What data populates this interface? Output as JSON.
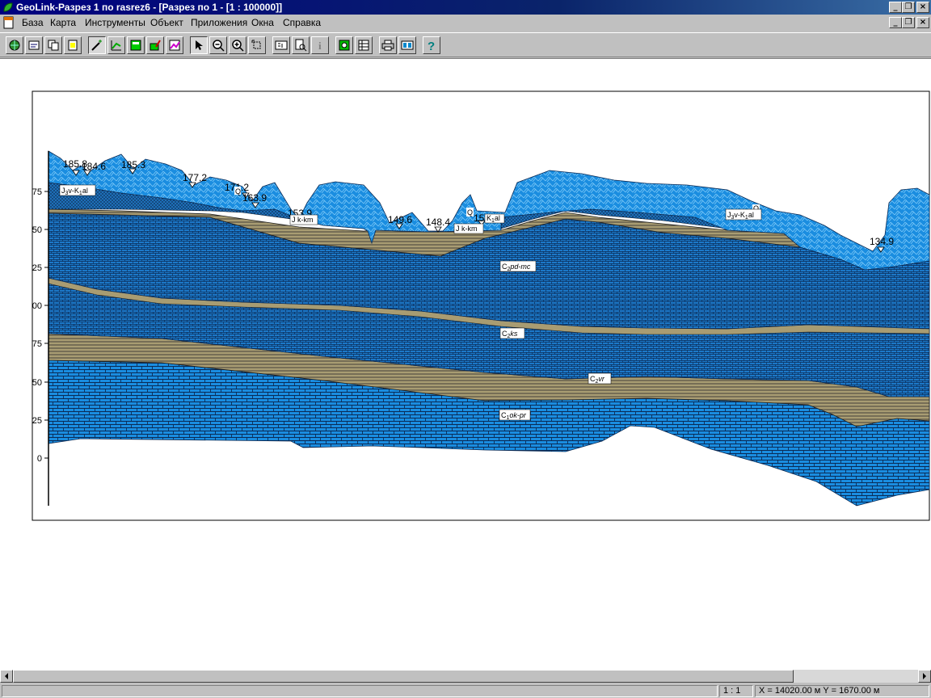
{
  "window": {
    "title": "GeoLink-Разрез 1 по rasrez6 - [Разрез по 1 - [1 : 100000]]"
  },
  "menu": {
    "items": [
      "База",
      "Карта",
      "Инструменты",
      "Объект",
      "Приложения",
      "Окна",
      "Справка"
    ]
  },
  "toolbar": {
    "buttons": [
      "open-db",
      "save-db",
      "copy-db",
      "new-doc",
      "magic-wand",
      "section-edit",
      "window-save",
      "edit-layer",
      "layer-chart",
      "select-arrow",
      "zoom-out",
      "zoom-in",
      "zoom-region",
      "layout-view",
      "search-view",
      "info",
      "add-object",
      "table-view",
      "print",
      "preview",
      "help"
    ]
  },
  "section": {
    "axis_ticks": [
      "75",
      "50",
      "25",
      "00",
      "75",
      "50",
      "25",
      "0"
    ],
    "elevation_labels": [
      "185.8",
      "184.6",
      "185.3",
      "177.2",
      "171.2",
      "163.9",
      "153.9",
      "149.6",
      "148.4",
      "150",
      "134.9"
    ],
    "q_labels": [
      "Q",
      "Q",
      "Q"
    ],
    "layer_labels": [
      {
        "base": "J",
        "sub": "3",
        "rest": "v-K",
        "sub2": "1",
        "tail": "al"
      },
      {
        "base": "J k-km",
        "sub": "",
        "rest": "",
        "sub2": "",
        "tail": ""
      },
      {
        "base": "J k-km",
        "sub": "",
        "rest": "",
        "sub2": "",
        "tail": ""
      },
      {
        "base": "K",
        "sub": "1",
        "rest": "al",
        "sub2": "",
        "tail": ""
      },
      {
        "base": "J",
        "sub": "3",
        "rest": "v-K",
        "sub2": "1",
        "tail": "al"
      },
      {
        "base": "C",
        "sub": "2",
        "rest": "pd-mc",
        "sub2": "",
        "tail": ""
      },
      {
        "base": "C",
        "sub": "2",
        "rest": "ks",
        "sub2": "",
        "tail": ""
      },
      {
        "base": "C",
        "sub": "2",
        "rest": "vr",
        "sub2": "",
        "tail": ""
      },
      {
        "base": "C",
        "sub": "1",
        "rest": "ok-pr",
        "sub2": "",
        "tail": ""
      }
    ]
  },
  "status": {
    "scale": "1 : 1",
    "coords": "X = 14020.00 м Y = 1670.00 м"
  },
  "colors": {
    "titlebar": "#000080",
    "limestone": "#1a8de0",
    "mudstone": "#1c78c8",
    "sand": "#a89c72",
    "alluvium": "#1e6fb8"
  }
}
